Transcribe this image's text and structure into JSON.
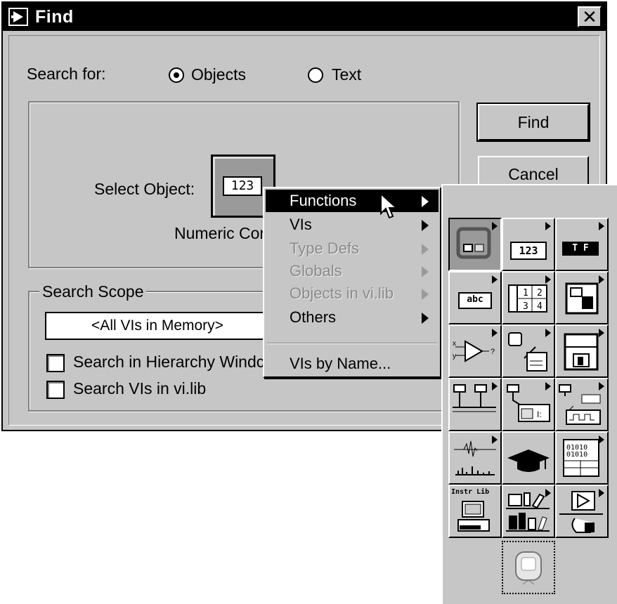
{
  "window": {
    "title": "Find",
    "close_label": "✕"
  },
  "search_for": {
    "label": "Search for:",
    "options": [
      {
        "label": "Objects",
        "selected": true
      },
      {
        "label": "Text",
        "selected": false
      }
    ]
  },
  "select_object": {
    "label": "Select Object:",
    "object_value": "123",
    "object_caption": "Numeric Cor"
  },
  "buttons": {
    "find": "Find",
    "cancel": "Cancel"
  },
  "search_scope": {
    "label": "Search Scope",
    "selected": "<All VIs in Memory>",
    "checkboxes": [
      {
        "label": "Search in Hierarchy Windc",
        "checked": false
      },
      {
        "label": "Search VIs in vi.lib",
        "checked": false
      }
    ]
  },
  "context_menu": {
    "items": [
      {
        "label": "Functions",
        "submenu": true,
        "enabled": true,
        "highlighted": true
      },
      {
        "label": "VIs",
        "submenu": true,
        "enabled": true
      },
      {
        "label": "Type Defs",
        "submenu": true,
        "enabled": false
      },
      {
        "label": "Globals",
        "submenu": true,
        "enabled": false
      },
      {
        "label": "Objects in vi.lib",
        "submenu": true,
        "enabled": false
      },
      {
        "label": "Others",
        "submenu": true,
        "enabled": true
      },
      {
        "label": "VIs by Name...",
        "submenu": false,
        "enabled": true
      }
    ]
  },
  "palette": {
    "tiles": [
      {
        "icon": "structures-icon"
      },
      {
        "icon": "numeric-icon",
        "text": "123"
      },
      {
        "icon": "boolean-icon",
        "text": "T F"
      },
      {
        "icon": "string-icon",
        "text": "abc"
      },
      {
        "icon": "array-cluster-icon",
        "text": "1 2 3 4"
      },
      {
        "icon": "cluster-icon"
      },
      {
        "icon": "comparison-icon"
      },
      {
        "icon": "time-dialog-icon"
      },
      {
        "icon": "file-io-icon"
      },
      {
        "icon": "instrument-io-icon"
      },
      {
        "icon": "data-acquisition-icon"
      },
      {
        "icon": "communication-icon"
      },
      {
        "icon": "analysis-icon"
      },
      {
        "icon": "tutorial-icon"
      },
      {
        "icon": "advanced-icon"
      },
      {
        "icon": "instrument-library-icon",
        "text": "Instr Lib"
      },
      {
        "icon": "user-libraries-icon"
      },
      {
        "icon": "select-vi-icon"
      },
      {
        "icon": "select-object-icon"
      }
    ]
  }
}
